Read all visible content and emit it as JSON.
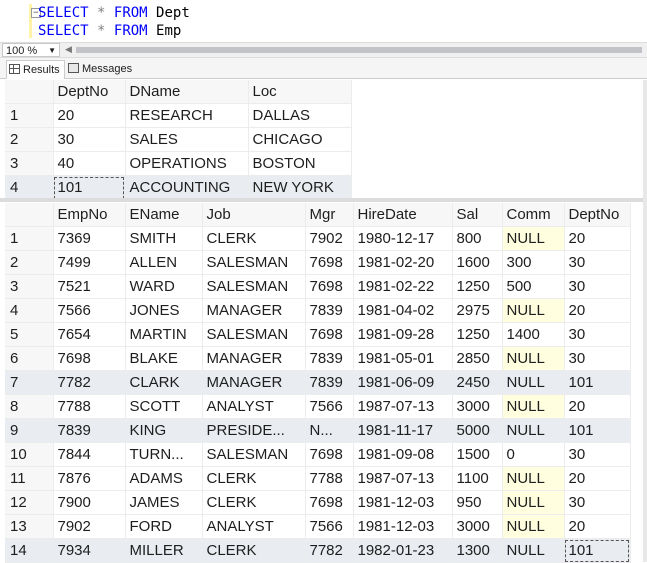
{
  "editor": {
    "lines": [
      {
        "kw1": "SELECT",
        "op": "*",
        "kw2": "FROM",
        "table": "Dept"
      },
      {
        "kw1": "SELECT",
        "op": "*",
        "kw2": "FROM",
        "table": "Emp"
      }
    ]
  },
  "zoom": {
    "value": "100 %"
  },
  "tabs": {
    "results": "Results",
    "messages": "Messages"
  },
  "dept": {
    "columns": [
      "DeptNo",
      "DName",
      "Loc"
    ],
    "rows": [
      [
        "1",
        "20",
        "RESEARCH",
        "DALLAS"
      ],
      [
        "2",
        "30",
        "SALES",
        "CHICAGO"
      ],
      [
        "3",
        "40",
        "OPERATIONS",
        "BOSTON"
      ],
      [
        "4",
        "101",
        "ACCOUNTING",
        "NEW YORK"
      ]
    ]
  },
  "emp": {
    "columns": [
      "EmpNo",
      "EName",
      "Job",
      "Mgr",
      "HireDate",
      "Sal",
      "Comm",
      "DeptNo"
    ],
    "rows": [
      [
        "1",
        "7369",
        "SMITH",
        "CLERK",
        "7902",
        "1980-12-17",
        "800",
        "NULL",
        "20"
      ],
      [
        "2",
        "7499",
        "ALLEN",
        "SALESMAN",
        "7698",
        "1981-02-20",
        "1600",
        "300",
        "30"
      ],
      [
        "3",
        "7521",
        "WARD",
        "SALESMAN",
        "7698",
        "1981-02-22",
        "1250",
        "500",
        "30"
      ],
      [
        "4",
        "7566",
        "JONES",
        "MANAGER",
        "7839",
        "1981-04-02",
        "2975",
        "NULL",
        "20"
      ],
      [
        "5",
        "7654",
        "MARTIN",
        "SALESMAN",
        "7698",
        "1981-09-28",
        "1250",
        "1400",
        "30"
      ],
      [
        "6",
        "7698",
        "BLAKE",
        "MANAGER",
        "7839",
        "1981-05-01",
        "2850",
        "NULL",
        "30"
      ],
      [
        "7",
        "7782",
        "CLARK",
        "MANAGER",
        "7839",
        "1981-06-09",
        "2450",
        "NULL",
        "101"
      ],
      [
        "8",
        "7788",
        "SCOTT",
        "ANALYST",
        "7566",
        "1987-07-13",
        "3000",
        "NULL",
        "20"
      ],
      [
        "9",
        "7839",
        "KING",
        "PRESIDE...",
        "N...",
        "1981-11-17",
        "5000",
        "NULL",
        "101"
      ],
      [
        "10",
        "7844",
        "TURN...",
        "SALESMAN",
        "7698",
        "1981-09-08",
        "1500",
        "0",
        "30"
      ],
      [
        "11",
        "7876",
        "ADAMS",
        "CLERK",
        "7788",
        "1987-07-13",
        "1100",
        "NULL",
        "20"
      ],
      [
        "12",
        "7900",
        "JAMES",
        "CLERK",
        "7698",
        "1981-12-03",
        "950",
        "NULL",
        "30"
      ],
      [
        "13",
        "7902",
        "FORD",
        "ANALYST",
        "7566",
        "1981-12-03",
        "3000",
        "NULL",
        "20"
      ],
      [
        "14",
        "7934",
        "MILLER",
        "CLERK",
        "7782",
        "1982-01-23",
        "1300",
        "NULL",
        "101"
      ]
    ]
  }
}
